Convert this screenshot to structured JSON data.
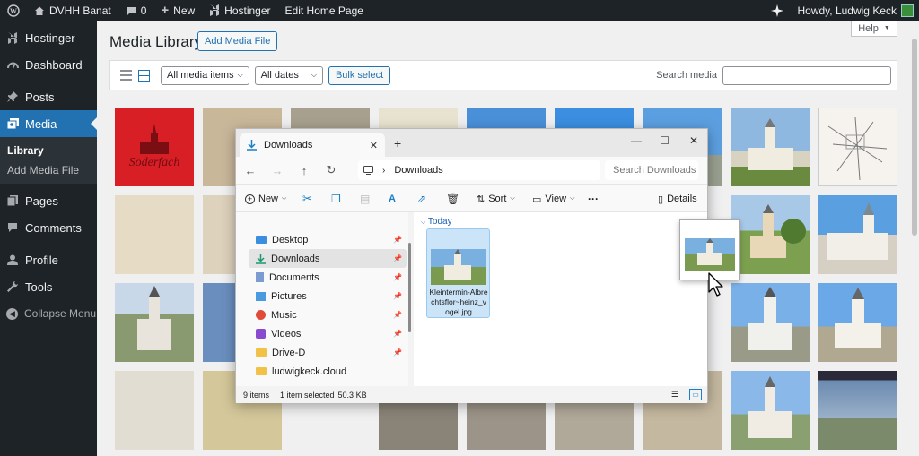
{
  "adminbar": {
    "site_name": "DVHH Banat",
    "comments_count": "0",
    "new_label": "New",
    "hostinger_label": "Hostinger",
    "edit_label": "Edit Home Page",
    "howdy": "Howdy, Ludwig Keck"
  },
  "sidebar": {
    "items": [
      {
        "label": "Hostinger",
        "icon": "hostinger-icon"
      },
      {
        "label": "Dashboard",
        "icon": "dashboard-icon"
      },
      {
        "label": "Posts",
        "icon": "pin-icon"
      },
      {
        "label": "Media",
        "icon": "media-icon"
      },
      {
        "label": "Pages",
        "icon": "page-icon"
      },
      {
        "label": "Comments",
        "icon": "comment-icon"
      },
      {
        "label": "Profile",
        "icon": "user-icon"
      },
      {
        "label": "Tools",
        "icon": "wrench-icon"
      }
    ],
    "submenu": [
      "Library",
      "Add Media File"
    ],
    "collapse": "Collapse Menu"
  },
  "main": {
    "help": "Help",
    "title": "Media Library",
    "add_media": "Add Media File",
    "filter_type": "All media items",
    "filter_date": "All dates",
    "bulk_select": "Bulk select",
    "search_label": "Search media"
  },
  "explorer": {
    "tab_title": "Downloads",
    "address": "Downloads",
    "search_placeholder": "Search Downloads",
    "cmd": {
      "new": "New",
      "sort": "Sort",
      "view": "View",
      "more": "···",
      "details": "Details"
    },
    "nav": [
      {
        "label": "Desktop",
        "pinned": true
      },
      {
        "label": "Downloads",
        "pinned": true
      },
      {
        "label": "Documents",
        "pinned": true
      },
      {
        "label": "Pictures",
        "pinned": true
      },
      {
        "label": "Music",
        "pinned": true
      },
      {
        "label": "Videos",
        "pinned": true
      },
      {
        "label": "Drive-D",
        "pinned": true
      },
      {
        "label": "ludwigkeck.cloud",
        "pinned": false
      }
    ],
    "group": "Today",
    "file_name": "Kleintermin-Albrechtsflor~heinz_vogel.jpg",
    "status": {
      "items": "9 items",
      "selected": "1 item selected",
      "size": "50.3 KB"
    }
  },
  "colors": {
    "wp_dark": "#1d2327",
    "wp_blue": "#2271b1",
    "arrow_red": "#e0262b",
    "selection": "#cce4f7"
  }
}
